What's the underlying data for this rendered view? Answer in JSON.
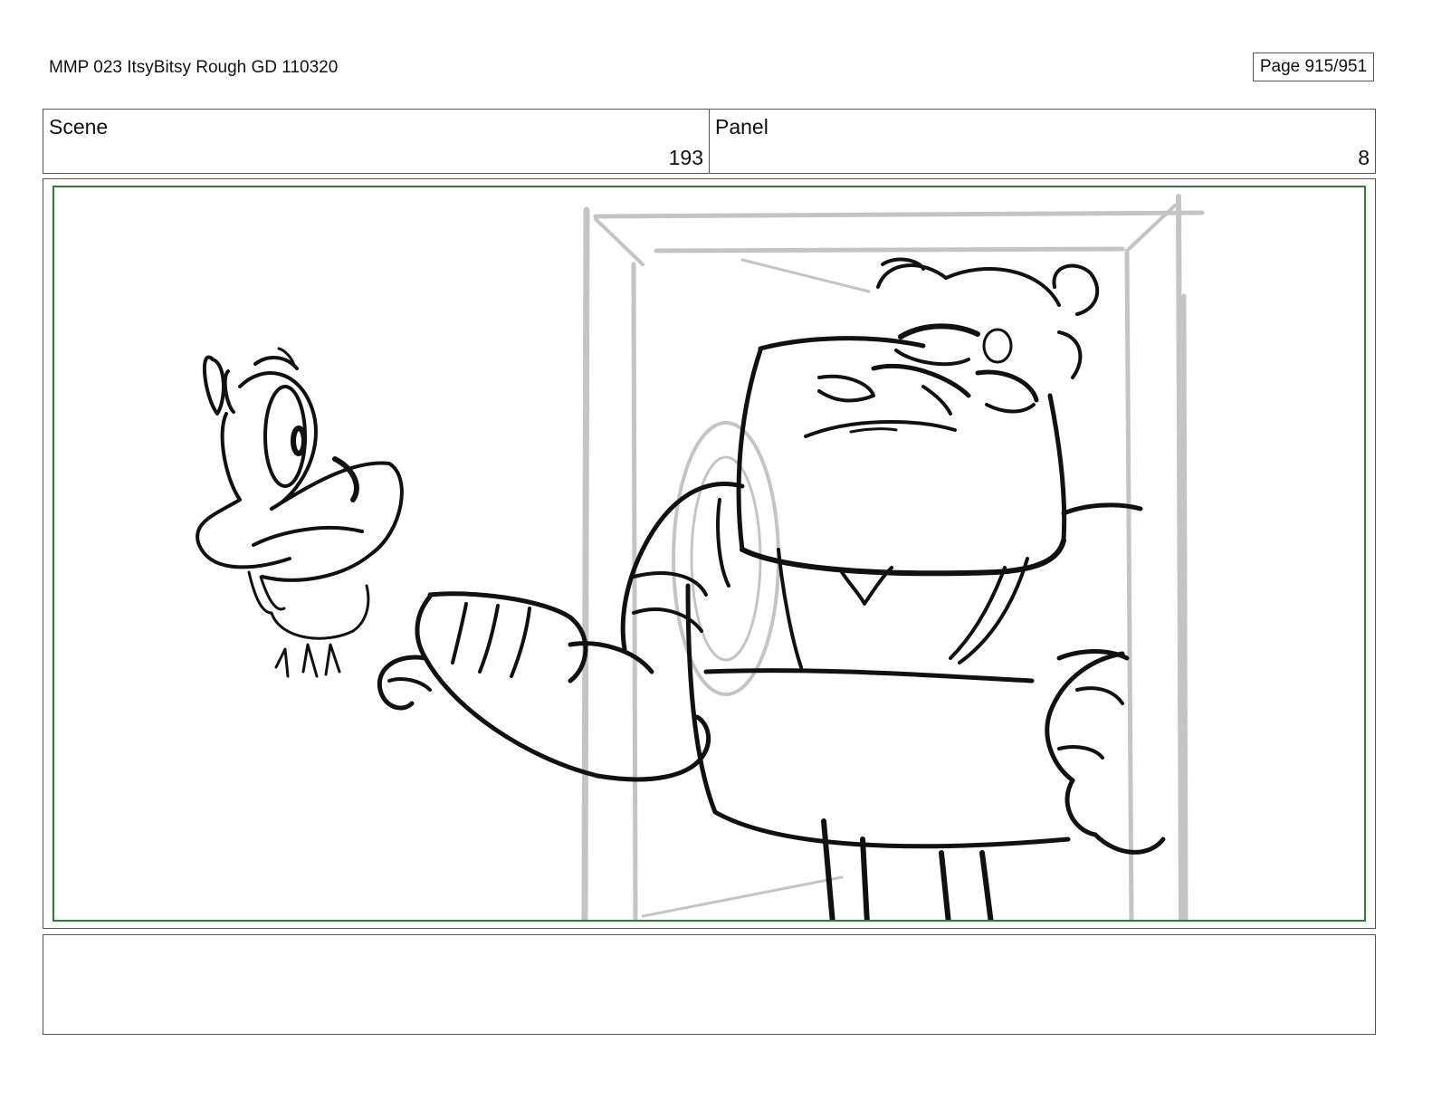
{
  "document": {
    "title": "MMP 023 ItsyBitsy Rough GD 110320",
    "page_label": "Page 915/951"
  },
  "info": {
    "scene_label": "Scene",
    "scene_value": "193",
    "panel_label": "Panel",
    "panel_value": "8"
  },
  "frame": {
    "safe_area_color": "#2e7d32"
  },
  "notes": {
    "text": ""
  }
}
